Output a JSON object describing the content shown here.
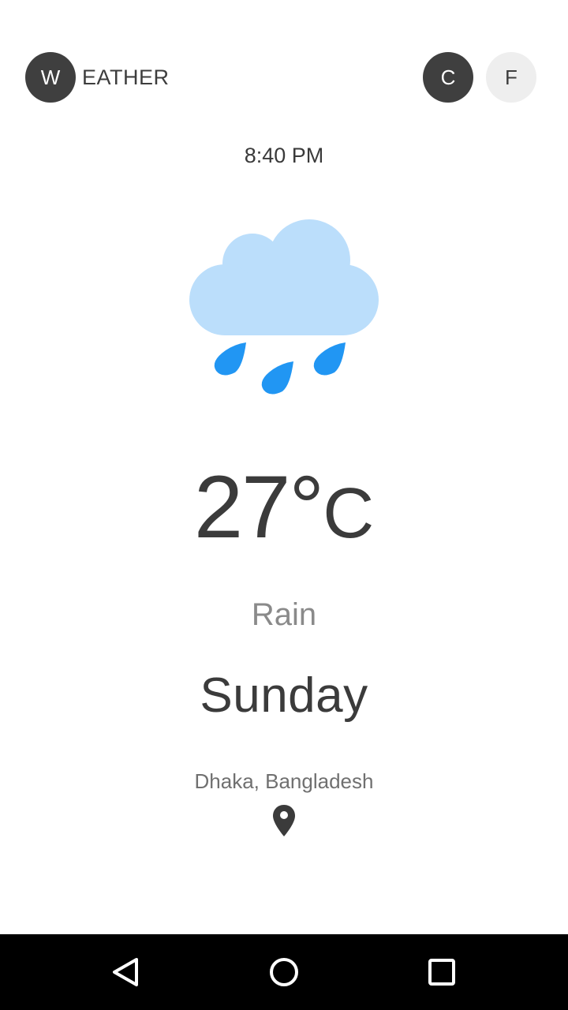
{
  "header": {
    "logo_letter": "W",
    "logo_text": "EATHER",
    "unit_celsius": "C",
    "unit_fahrenheit": "F"
  },
  "weather": {
    "time": "8:40 PM",
    "icon": "rain-cloud-icon",
    "temperature": "27°",
    "temperature_unit": "C",
    "condition": "Rain",
    "day": "Sunday",
    "location": "Dhaka, Bangladesh"
  },
  "colors": {
    "dark": "#3f3f3f",
    "light": "#eeeeee",
    "cloud": "#bbdefb",
    "raindrop": "#2196f3"
  },
  "navbar": {
    "back": "back-icon",
    "home": "home-icon",
    "recent": "recent-apps-icon"
  }
}
